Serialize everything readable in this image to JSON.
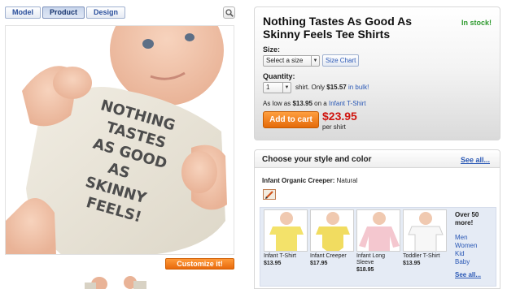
{
  "view_tabs": [
    {
      "label": "Model",
      "active": false
    },
    {
      "label": "Product",
      "active": true
    },
    {
      "label": "Design",
      "active": false
    }
  ],
  "zoom_icon": "magnifier-icon",
  "shirt_print": [
    "NOTHING",
    "TASTES",
    "AS GOOD",
    "AS",
    "SKINNY",
    "FEELS!"
  ],
  "customize_label": "Customize it!",
  "buy": {
    "title": "Nothing Tastes As Good As Skinny Feels Tee Shirts",
    "stock": "In stock!",
    "size_label": "Size:",
    "size_value": "Select a size",
    "size_chart": "Size Chart",
    "quantity_label": "Quantity:",
    "quantity_value": "1",
    "qty_suffix": "shirt. Only",
    "bulk_price": "$15.57",
    "bulk_link": "in bulk!",
    "low_prefix": "As low as",
    "low_price": "$13.95",
    "low_on": "on a",
    "low_link": "Infant T-Shirt",
    "add_to_cart": "Add to cart",
    "price": "$23.95",
    "per_shirt": "per shirt",
    "accent_color": "#e8720c",
    "price_color": "#d0150f",
    "stock_color": "#2e9a2e"
  },
  "style": {
    "header": "Choose your style and color",
    "see_all": "See all...",
    "current_style": "Infant Organic Creeper:",
    "current_color": "Natural",
    "options": [
      {
        "name": "Infant T-Shirt",
        "price": "$13.95",
        "shirt_color": "#f3e26a"
      },
      {
        "name": "Infant Creeper",
        "price": "$17.95",
        "shirt_color": "#f1dc60"
      },
      {
        "name": "Infant Long Sleeve",
        "price": "$18.95",
        "shirt_color": "#f4c7cf"
      },
      {
        "name": "Toddler T-Shirt",
        "price": "$13.95",
        "shirt_color": "#f7f7f7"
      }
    ],
    "more_title": "Over 50 more!",
    "more_links": [
      "Men",
      "Women",
      "Kid",
      "Baby"
    ],
    "more_see_all": "See all..."
  }
}
